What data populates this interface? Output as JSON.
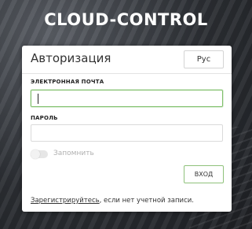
{
  "app": {
    "title": "CLOUD-CONTROL"
  },
  "auth": {
    "title": "Авторизация",
    "lang_button": "Рус",
    "email_label": "ЭЛЕКТРОННАЯ ПОЧТА",
    "email_value": "",
    "password_label": "ПАРОЛЬ",
    "password_value": "",
    "remember_label": "Запомнить",
    "remember_checked": false,
    "login_button": "ВХОД",
    "register_link": "Зарегистрируйтесь",
    "register_suffix": ", если нет учетной записи."
  },
  "colors": {
    "accent": "#8fc27b",
    "background": "#2a2d31"
  }
}
